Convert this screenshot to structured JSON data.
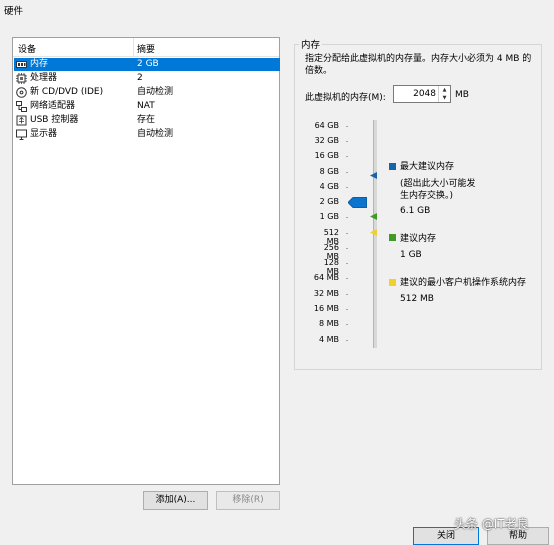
{
  "window": {
    "title": "硬件"
  },
  "device_list": {
    "headers": {
      "device": "设备",
      "summary": "摘要"
    },
    "items": [
      {
        "name": "内存",
        "summary": "2 GB",
        "icon": "memory-icon",
        "selected": true
      },
      {
        "name": "处理器",
        "summary": "2",
        "icon": "processor-icon",
        "selected": false
      },
      {
        "name": "新 CD/DVD (IDE)",
        "summary": "自动检测",
        "icon": "cd-dvd-icon",
        "selected": false
      },
      {
        "name": "网络适配器",
        "summary": "NAT",
        "icon": "network-adapter-icon",
        "selected": false
      },
      {
        "name": "USB 控制器",
        "summary": "存在",
        "icon": "usb-icon",
        "selected": false
      },
      {
        "name": "显示器",
        "summary": "自动检测",
        "icon": "monitor-icon",
        "selected": false
      }
    ]
  },
  "buttons": {
    "add": "添加(A)...",
    "remove": "移除(R)",
    "close": "关闭",
    "help": "帮助"
  },
  "memory": {
    "group_title": "内存",
    "description": "指定分配给此虚拟机的内存量。内存大小必须为 4 MB 的倍数。",
    "field_label": "此虚拟机的内存(M):",
    "value": "2048",
    "unit": "MB",
    "scale_labels": [
      "64 GB",
      "32 GB",
      "16 GB",
      "8 GB",
      "4 GB",
      "2 GB",
      "1 GB",
      "512 MB",
      "256 MB",
      "128 MB",
      "64 MB",
      "32 MB",
      "16 MB",
      "8 MB",
      "4 MB"
    ],
    "legend": [
      {
        "title": "最大建议内存",
        "note": "(超出此大小可能发生内存交换。)",
        "value": "6.1 GB",
        "color": "#1565a8"
      },
      {
        "title": "建议内存",
        "value": "1 GB",
        "color": "#3f9b25"
      },
      {
        "title": "建议的最小客户机操作系统内存",
        "value": "512 MB",
        "color": "#f0d02c"
      }
    ]
  },
  "watermark": "头条 @IT老良",
  "colors": {
    "selection": "#0078d7",
    "background": "#f0f0f0"
  }
}
